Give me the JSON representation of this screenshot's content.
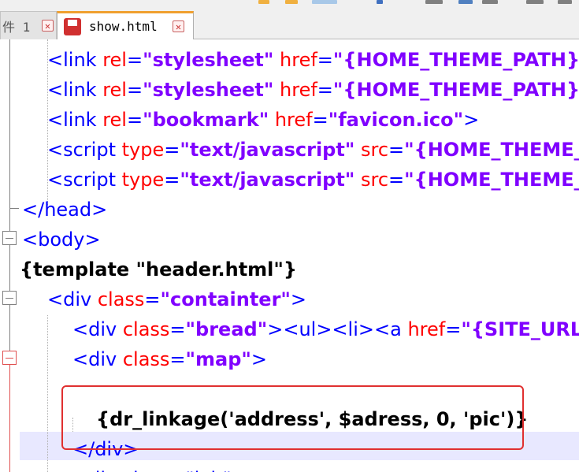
{
  "tabs": [
    {
      "label": "件 1",
      "active": false
    },
    {
      "label": "show.html",
      "active": true
    }
  ],
  "editor": {
    "lines": [
      [
        {
          "c": "t",
          "v": "<link "
        },
        {
          "c": "a",
          "v": "rel"
        },
        {
          "c": "t",
          "v": "="
        },
        {
          "c": "s",
          "v": "\"stylesheet\""
        },
        {
          "c": "t",
          "v": " "
        },
        {
          "c": "a",
          "v": "href"
        },
        {
          "c": "t",
          "v": "="
        },
        {
          "c": "s",
          "v": "\"{HOME_THEME_PATH}w"
        }
      ],
      [
        {
          "c": "t",
          "v": "<link "
        },
        {
          "c": "a",
          "v": "rel"
        },
        {
          "c": "t",
          "v": "="
        },
        {
          "c": "s",
          "v": "\"stylesheet\""
        },
        {
          "c": "t",
          "v": " "
        },
        {
          "c": "a",
          "v": "href"
        },
        {
          "c": "t",
          "v": "="
        },
        {
          "c": "s",
          "v": "\"{HOME_THEME_PATH}w"
        }
      ],
      [
        {
          "c": "t",
          "v": "<link "
        },
        {
          "c": "a",
          "v": "rel"
        },
        {
          "c": "t",
          "v": "="
        },
        {
          "c": "s",
          "v": "\"bookmark\""
        },
        {
          "c": "t",
          "v": " "
        },
        {
          "c": "a",
          "v": "href"
        },
        {
          "c": "t",
          "v": "="
        },
        {
          "c": "s",
          "v": "\"favicon.ico\""
        },
        {
          "c": "t",
          "v": ">"
        }
      ],
      [
        {
          "c": "t",
          "v": "<script "
        },
        {
          "c": "a",
          "v": "type"
        },
        {
          "c": "t",
          "v": "="
        },
        {
          "c": "s",
          "v": "\"text/javascript\""
        },
        {
          "c": "t",
          "v": " "
        },
        {
          "c": "a",
          "v": "src"
        },
        {
          "c": "t",
          "v": "="
        },
        {
          "c": "s",
          "v": "\"{HOME_THEME_P"
        }
      ],
      [
        {
          "c": "t",
          "v": "<script "
        },
        {
          "c": "a",
          "v": "type"
        },
        {
          "c": "t",
          "v": "="
        },
        {
          "c": "s",
          "v": "\"text/javascript\""
        },
        {
          "c": "t",
          "v": " "
        },
        {
          "c": "a",
          "v": "src"
        },
        {
          "c": "t",
          "v": "="
        },
        {
          "c": "s",
          "v": "\"{HOME_THEME_P"
        }
      ],
      [
        {
          "c": "t",
          "v": "</head>"
        }
      ],
      [
        {
          "c": "t",
          "v": "<body>"
        }
      ],
      [
        {
          "c": "x",
          "v": "{template \"header.html\"}"
        }
      ],
      [
        {
          "c": "t",
          "v": "<div "
        },
        {
          "c": "a",
          "v": "class"
        },
        {
          "c": "t",
          "v": "="
        },
        {
          "c": "s",
          "v": "\"containter\""
        },
        {
          "c": "t",
          "v": ">"
        }
      ],
      [
        {
          "c": "t",
          "v": "<div "
        },
        {
          "c": "a",
          "v": "class"
        },
        {
          "c": "t",
          "v": "="
        },
        {
          "c": "s",
          "v": "\"bread\""
        },
        {
          "c": "t",
          "v": "><ul><li><a "
        },
        {
          "c": "a",
          "v": "href"
        },
        {
          "c": "t",
          "v": "="
        },
        {
          "c": "s",
          "v": "\"{SITE_URL}\""
        }
      ],
      [
        {
          "c": "t",
          "v": "<div "
        },
        {
          "c": "a",
          "v": "class"
        },
        {
          "c": "t",
          "v": "="
        },
        {
          "c": "s",
          "v": "\"map\""
        },
        {
          "c": "t",
          "v": ">"
        }
      ],
      [],
      [
        {
          "c": "x",
          "v": "{dr_linkage('address', $adress, 0, 'pic')}"
        }
      ],
      [
        {
          "c": "t",
          "v": "</div>"
        }
      ],
      [
        {
          "c": "t",
          "v": "<div class=\"lvb\">"
        }
      ]
    ]
  }
}
